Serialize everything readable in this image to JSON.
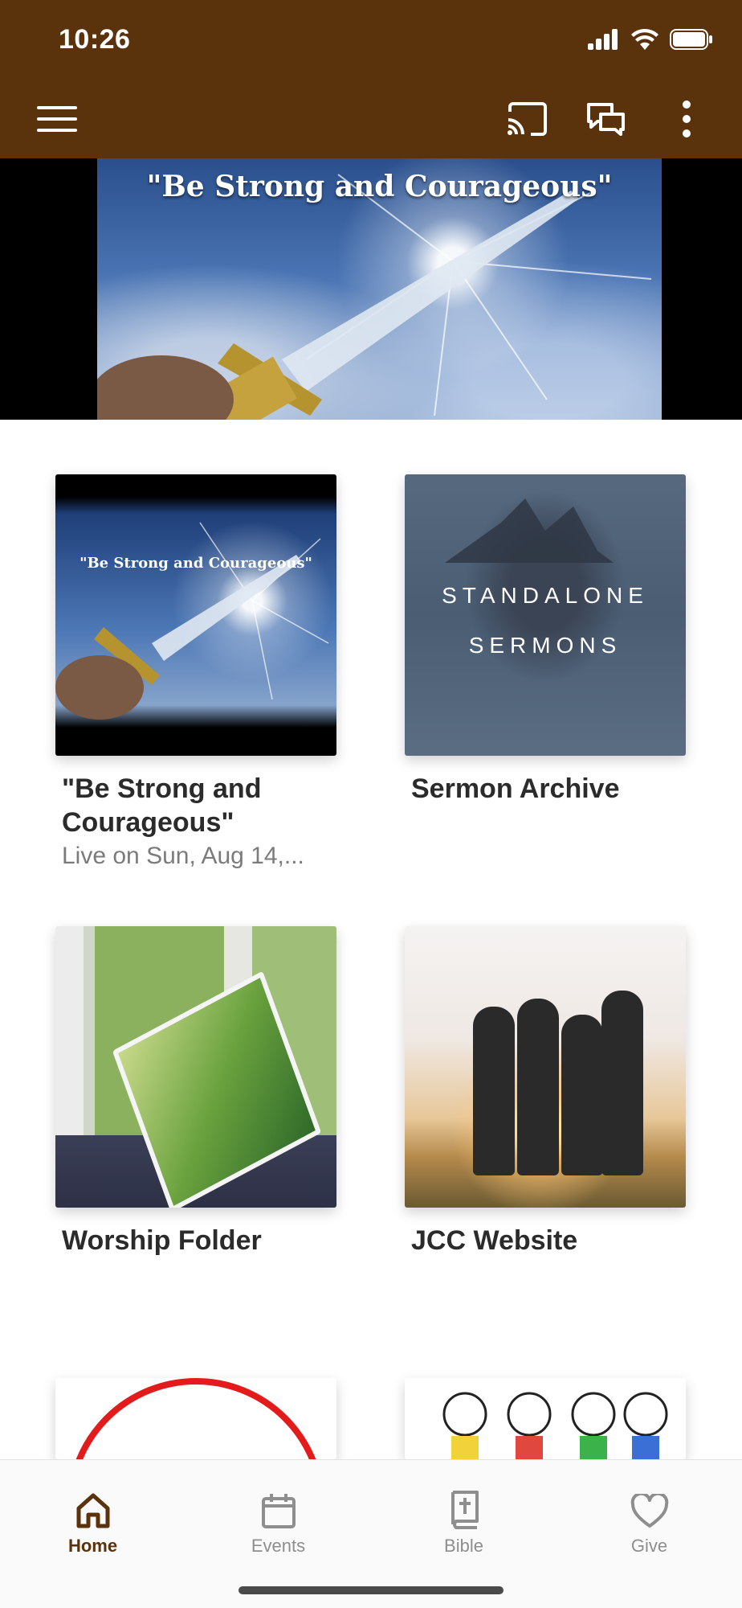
{
  "status_bar": {
    "time": "10:26"
  },
  "hero": {
    "title": "\"Be Strong and Courageous\""
  },
  "tiles": [
    {
      "title": "\"Be Strong and Courageous\"",
      "subtitle": "Live on Sun, Aug 14,...",
      "image_text": "\"Be Strong and Courageous\""
    },
    {
      "title": "Sermon Archive",
      "image_text_line1": "STANDALONE",
      "image_text_line2": "SERMONS"
    },
    {
      "title": "Worship Folder"
    },
    {
      "title": "JCC Website"
    }
  ],
  "tabbar": {
    "items": [
      {
        "label": "Home",
        "icon": "home-icon",
        "active": true
      },
      {
        "label": "Events",
        "icon": "calendar-icon",
        "active": false
      },
      {
        "label": "Bible",
        "icon": "bible-icon",
        "active": false
      },
      {
        "label": "Give",
        "icon": "heart-icon",
        "active": false
      }
    ]
  },
  "colors": {
    "brand": "#5a330c",
    "tab_inactive": "#8e8e8e"
  }
}
